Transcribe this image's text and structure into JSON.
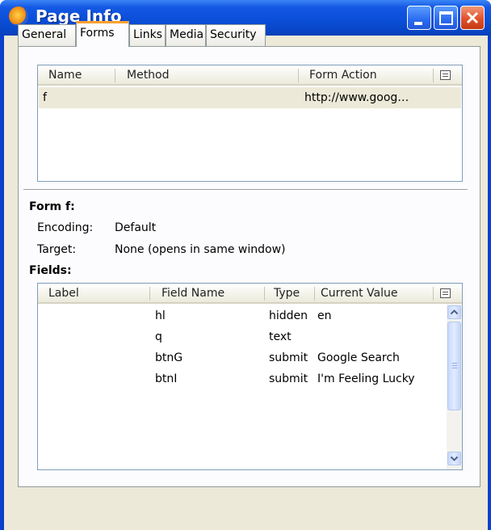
{
  "window": {
    "title": "Page Info",
    "icon": "firefox-icon",
    "controls": [
      "minimize-icon",
      "maximize-icon",
      "close-icon"
    ]
  },
  "tabs": [
    {
      "label": "General",
      "active": false
    },
    {
      "label": "Forms",
      "active": true
    },
    {
      "label": "Links",
      "active": false
    },
    {
      "label": "Media",
      "active": false
    },
    {
      "label": "Security",
      "active": false
    }
  ],
  "forms_list": {
    "columns": [
      "Name",
      "Method",
      "Form Action"
    ],
    "rows": [
      {
        "name": "f",
        "method": "",
        "action": "http://www.goog…"
      }
    ]
  },
  "form_details": {
    "heading": "Form f:",
    "encoding_label": "Encoding:",
    "encoding_value": "Default",
    "target_label": "Target:",
    "target_value": "None (opens in same window)"
  },
  "fields_section": {
    "heading": "Fields:",
    "columns": [
      "Label",
      "Field Name",
      "Type",
      "Current Value"
    ],
    "rows": [
      {
        "label": "",
        "name": "hl",
        "type": "hidden",
        "value": "en"
      },
      {
        "label": "",
        "name": "q",
        "type": "text",
        "value": ""
      },
      {
        "label": "",
        "name": "btnG",
        "type": "submit",
        "value": "Google Search"
      },
      {
        "label": "",
        "name": "btnI",
        "type": "submit",
        "value": "I'm Feeling Lucky"
      }
    ]
  },
  "colors": {
    "title_bar": "#0b4fd9",
    "window_bg": "#ece9d8",
    "active_tab_accent": "#f6a030",
    "close_button": "#e1512a"
  }
}
